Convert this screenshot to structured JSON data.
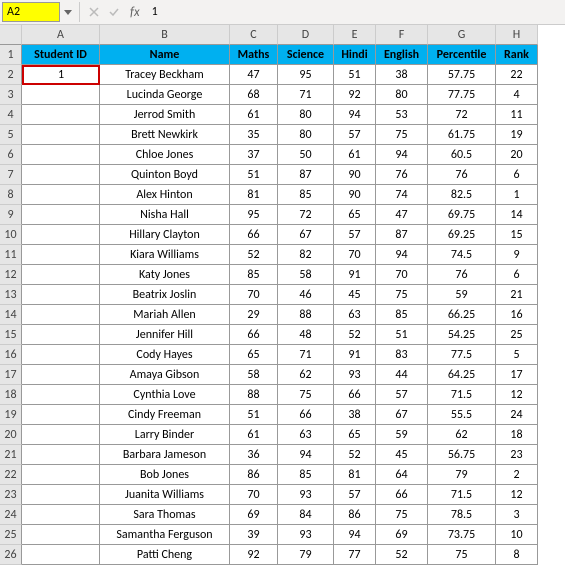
{
  "formula_bar": {
    "name_box": "A2",
    "formula": "1"
  },
  "col_headers": [
    "A",
    "B",
    "C",
    "D",
    "E",
    "F",
    "G",
    "H"
  ],
  "headers": {
    "student_id": "Student ID",
    "name": "Name",
    "maths": "Maths",
    "science": "Science",
    "hindi": "Hindi",
    "english": "English",
    "percentile": "Percentile",
    "rank": "Rank"
  },
  "rows": [
    {
      "id": "1",
      "name": "Tracey Beckham",
      "m": "47",
      "s": "95",
      "h": "51",
      "e": "38",
      "p": "57.75",
      "r": "22"
    },
    {
      "id": "",
      "name": "Lucinda George",
      "m": "68",
      "s": "71",
      "h": "92",
      "e": "80",
      "p": "77.75",
      "r": "4"
    },
    {
      "id": "",
      "name": "Jerrod Smith",
      "m": "61",
      "s": "80",
      "h": "94",
      "e": "53",
      "p": "72",
      "r": "11"
    },
    {
      "id": "",
      "name": "Brett Newkirk",
      "m": "35",
      "s": "80",
      "h": "57",
      "e": "75",
      "p": "61.75",
      "r": "19"
    },
    {
      "id": "",
      "name": "Chloe Jones",
      "m": "37",
      "s": "50",
      "h": "61",
      "e": "94",
      "p": "60.5",
      "r": "20"
    },
    {
      "id": "",
      "name": "Quinton Boyd",
      "m": "51",
      "s": "87",
      "h": "90",
      "e": "76",
      "p": "76",
      "r": "6"
    },
    {
      "id": "",
      "name": "Alex Hinton",
      "m": "81",
      "s": "85",
      "h": "90",
      "e": "74",
      "p": "82.5",
      "r": "1"
    },
    {
      "id": "",
      "name": "Nisha Hall",
      "m": "95",
      "s": "72",
      "h": "65",
      "e": "47",
      "p": "69.75",
      "r": "14"
    },
    {
      "id": "",
      "name": "Hillary Clayton",
      "m": "66",
      "s": "67",
      "h": "57",
      "e": "87",
      "p": "69.25",
      "r": "15"
    },
    {
      "id": "",
      "name": "Kiara Williams",
      "m": "52",
      "s": "82",
      "h": "70",
      "e": "94",
      "p": "74.5",
      "r": "9"
    },
    {
      "id": "",
      "name": "Katy Jones",
      "m": "85",
      "s": "58",
      "h": "91",
      "e": "70",
      "p": "76",
      "r": "6"
    },
    {
      "id": "",
      "name": "Beatrix Joslin",
      "m": "70",
      "s": "46",
      "h": "45",
      "e": "75",
      "p": "59",
      "r": "21"
    },
    {
      "id": "",
      "name": "Mariah Allen",
      "m": "29",
      "s": "88",
      "h": "63",
      "e": "85",
      "p": "66.25",
      "r": "16"
    },
    {
      "id": "",
      "name": "Jennifer Hill",
      "m": "66",
      "s": "48",
      "h": "52",
      "e": "51",
      "p": "54.25",
      "r": "25"
    },
    {
      "id": "",
      "name": "Cody Hayes",
      "m": "65",
      "s": "71",
      "h": "91",
      "e": "83",
      "p": "77.5",
      "r": "5"
    },
    {
      "id": "",
      "name": "Amaya Gibson",
      "m": "58",
      "s": "62",
      "h": "93",
      "e": "44",
      "p": "64.25",
      "r": "17"
    },
    {
      "id": "",
      "name": "Cynthia Love",
      "m": "88",
      "s": "75",
      "h": "66",
      "e": "57",
      "p": "71.5",
      "r": "12"
    },
    {
      "id": "",
      "name": "Cindy Freeman",
      "m": "51",
      "s": "66",
      "h": "38",
      "e": "67",
      "p": "55.5",
      "r": "24"
    },
    {
      "id": "",
      "name": "Larry Binder",
      "m": "61",
      "s": "63",
      "h": "65",
      "e": "59",
      "p": "62",
      "r": "18"
    },
    {
      "id": "",
      "name": "Barbara Jameson",
      "m": "36",
      "s": "94",
      "h": "52",
      "e": "45",
      "p": "56.75",
      "r": "23"
    },
    {
      "id": "",
      "name": "Bob Jones",
      "m": "86",
      "s": "85",
      "h": "81",
      "e": "64",
      "p": "79",
      "r": "2"
    },
    {
      "id": "",
      "name": "Juanita Williams",
      "m": "70",
      "s": "93",
      "h": "57",
      "e": "66",
      "p": "71.5",
      "r": "12"
    },
    {
      "id": "",
      "name": "Sara Thomas",
      "m": "69",
      "s": "84",
      "h": "86",
      "e": "75",
      "p": "78.5",
      "r": "3"
    },
    {
      "id": "",
      "name": "Samantha Ferguson",
      "m": "39",
      "s": "93",
      "h": "94",
      "e": "69",
      "p": "73.75",
      "r": "10"
    },
    {
      "id": "",
      "name": "Patti Cheng",
      "m": "92",
      "s": "79",
      "h": "77",
      "e": "52",
      "p": "75",
      "r": "8"
    }
  ]
}
